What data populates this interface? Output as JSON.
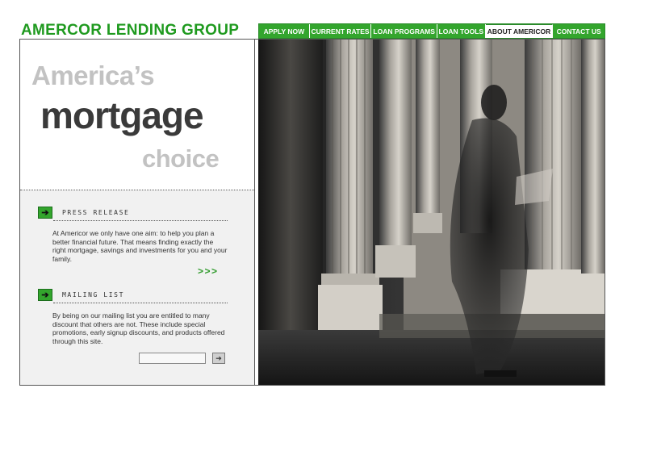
{
  "brand": {
    "logo_text": "AMERCOR LENDING GROUP",
    "accent_color": "#33a52d"
  },
  "nav": {
    "items": [
      {
        "label": "APPLY NOW"
      },
      {
        "label": "CURRENT RATES"
      },
      {
        "label": "LOAN PROGRAMS"
      },
      {
        "label": "LOAN TOOLS"
      },
      {
        "label": "ABOUT AMERICOR",
        "active": true
      },
      {
        "label": "CONTACT US"
      }
    ]
  },
  "hero": {
    "line1": "America’s",
    "line2": "mortgage",
    "line3": "choice"
  },
  "press_release": {
    "title": "PRESS RELEASE",
    "icon": "arrow-right-icon",
    "body": "At Americor we only have one aim: to help you plan a better financial future. That means finding exactly the right mortgage, savings and investments for you and your family.",
    "more_label": ">>>"
  },
  "mailing_list": {
    "title": "MAILING LIST",
    "icon": "arrow-right-icon",
    "body": "By being on our mailing list you are entitled to many discount that others are not. These include special promotions, early signup discounts, and products offered through this site.",
    "email_value": "",
    "submit_icon": "arrow-right-icon"
  }
}
